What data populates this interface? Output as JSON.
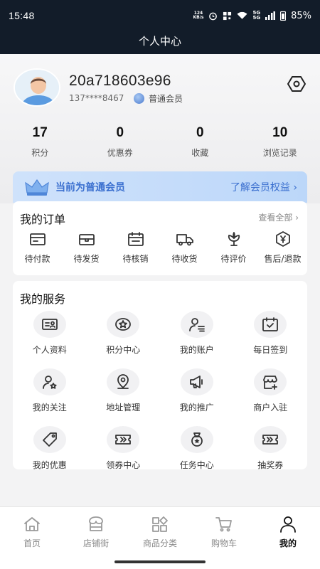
{
  "status_bar": {
    "time": "15:48",
    "net_speed_top": "124",
    "net_speed_unit": "KB/s",
    "sim_top": "5G",
    "sim_bottom": "5G",
    "battery": "85%"
  },
  "nav": {
    "title": "个人中心"
  },
  "profile": {
    "username": "20a718603e96",
    "phone": "137****8467",
    "level": "普通会员"
  },
  "stats": [
    {
      "value": "17",
      "label": "积分"
    },
    {
      "value": "0",
      "label": "优惠券"
    },
    {
      "value": "0",
      "label": "收藏"
    },
    {
      "value": "10",
      "label": "浏览记录"
    }
  ],
  "member": {
    "text": "当前为普通会员",
    "link": "了解会员权益 ›"
  },
  "orders": {
    "title": "我的订单",
    "more": "查看全部 ›",
    "items": [
      {
        "label": "待付款",
        "icon": "wallet-icon"
      },
      {
        "label": "待发货",
        "icon": "package-icon"
      },
      {
        "label": "待核销",
        "icon": "calendar-icon"
      },
      {
        "label": "待收货",
        "icon": "truck-icon"
      },
      {
        "label": "待评价",
        "icon": "flower-icon"
      },
      {
        "label": "售后/退款",
        "icon": "yen-icon"
      }
    ]
  },
  "services": {
    "title": "我的服务",
    "items": [
      {
        "label": "个人资料",
        "icon": "id-card-icon"
      },
      {
        "label": "积分中心",
        "icon": "star-badge-icon"
      },
      {
        "label": "我的账户",
        "icon": "user-list-icon"
      },
      {
        "label": "每日签到",
        "icon": "calendar-check-icon"
      },
      {
        "label": "我的关注",
        "icon": "user-star-icon"
      },
      {
        "label": "地址管理",
        "icon": "location-icon"
      },
      {
        "label": "我的推广",
        "icon": "megaphone-icon"
      },
      {
        "label": "商户入驻",
        "icon": "store-add-icon"
      },
      {
        "label": "我的优惠",
        "icon": "tag-icon"
      },
      {
        "label": "领券中心",
        "icon": "ticket-icon"
      },
      {
        "label": "任务中心",
        "icon": "medal-icon"
      },
      {
        "label": "抽奖券",
        "icon": "lottery-ticket-icon"
      }
    ]
  },
  "tabbar": {
    "items": [
      {
        "label": "首页",
        "icon": "home-icon"
      },
      {
        "label": "店铺街",
        "icon": "shop-icon"
      },
      {
        "label": "商品分类",
        "icon": "category-icon"
      },
      {
        "label": "购物车",
        "icon": "cart-icon"
      },
      {
        "label": "我的",
        "icon": "user-icon",
        "active": true
      }
    ]
  },
  "colors": {
    "header_bg": "#121c29",
    "accent_blue": "#3a6fcf",
    "member_banner": "#cfe2fb"
  }
}
